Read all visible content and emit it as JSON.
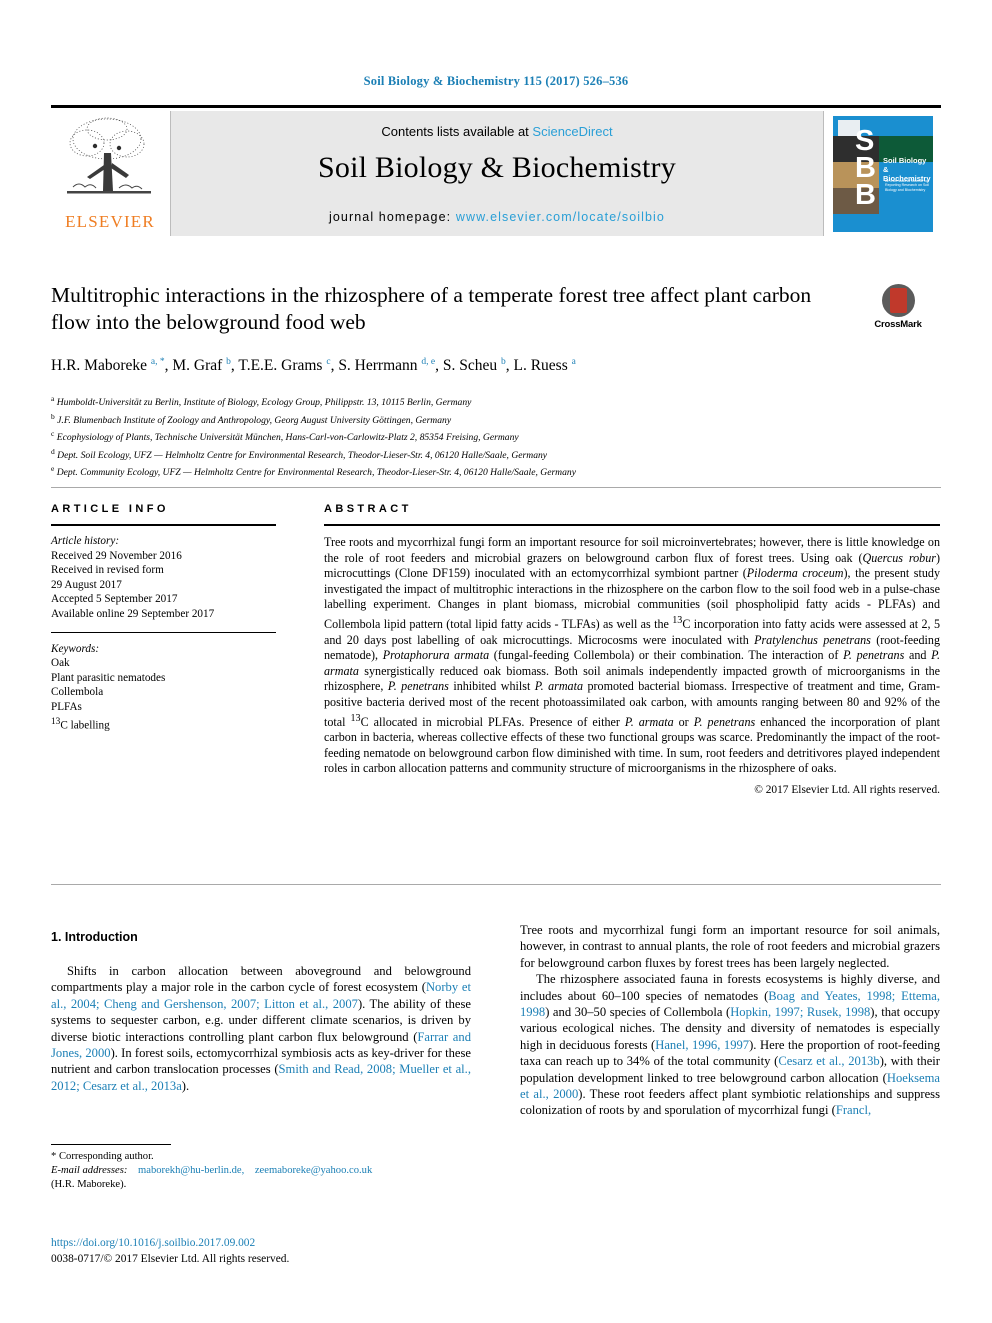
{
  "running_head": "Soil Biology & Biochemistry 115 (2017) 526–536",
  "masthead": {
    "contents_prefix": "Contents lists available at ",
    "sciencedirect": "ScienceDirect",
    "journal_name": "Soil Biology & Biochemistry",
    "homepage_prefix": "journal homepage: ",
    "homepage_url": "www.elsevier.com/locate/soilbio",
    "publisher_wordmark": "ELSEVIER",
    "cover": {
      "letters": "S\nB\nB",
      "title_line1": "Soil Biology &",
      "title_line2": "Biochemistry",
      "subtext": "An International Journal for Reporting Research on Soil Biology and Biochemistry"
    }
  },
  "colors": {
    "link_blue": "#1b7fb5",
    "sciencedirect_blue": "#2a9fd6",
    "elsevier_orange": "#ef7d22",
    "cover_blue": "#1a8fd0",
    "masthead_grey": "#e8e8e8"
  },
  "article": {
    "title": "Multitrophic interactions in the rhizosphere of a temperate forest tree affect plant carbon flow into the belowground food web",
    "crossmark_label": "CrossMark",
    "authors": [
      {
        "name": "H.R. Maboreke",
        "marks": "a, *"
      },
      {
        "name": "M. Graf",
        "marks": "b"
      },
      {
        "name": "T.E.E. Grams",
        "marks": "c"
      },
      {
        "name": "S. Herrmann",
        "marks": "d, e"
      },
      {
        "name": "S. Scheu",
        "marks": "b"
      },
      {
        "name": "L. Ruess",
        "marks": "a"
      }
    ],
    "affiliations": [
      {
        "mark": "a",
        "text": "Humboldt-Universität zu Berlin, Institute of Biology, Ecology Group, Philippstr. 13, 10115 Berlin, Germany"
      },
      {
        "mark": "b",
        "text": "J.F. Blumenbach Institute of Zoology and Anthropology, Georg August University Göttingen, Germany"
      },
      {
        "mark": "c",
        "text": "Ecophysiology of Plants, Technische Universität München, Hans-Carl-von-Carlowitz-Platz 2, 85354 Freising, Germany"
      },
      {
        "mark": "d",
        "text": "Dept. Soil Ecology, UFZ — Helmholtz Centre for Environmental Research, Theodor-Lieser-Str. 4, 06120 Halle/Saale, Germany"
      },
      {
        "mark": "e",
        "text": "Dept. Community Ecology, UFZ — Helmholtz Centre for Environmental Research, Theodor-Lieser-Str. 4, 06120 Halle/Saale, Germany"
      }
    ]
  },
  "article_info": {
    "heading": "ARTICLE INFO",
    "history_label": "Article history:",
    "history": [
      "Received 29 November 2016",
      "Received in revised form",
      "29 August 2017",
      "Accepted 5 September 2017",
      "Available online 29 September 2017"
    ],
    "keywords_label": "Keywords:",
    "keywords": [
      "Oak",
      "Plant parasitic nematodes",
      "Collembola",
      "PLFAs",
      "13C labelling"
    ]
  },
  "abstract": {
    "heading": "ABSTRACT",
    "text": "Tree roots and mycorrhizal fungi form an important resource for soil microinvertebrates; however, there is little knowledge on the role of root feeders and microbial grazers on belowground carbon flux of forest trees. Using oak (Quercus robur) microcuttings (Clone DF159) inoculated with an ectomycorrhizal symbiont partner (Piloderma croceum), the present study investigated the impact of multitrophic interactions in the rhizosphere on the carbon flow to the soil food web in a pulse-chase labelling experiment. Changes in plant biomass, microbial communities (soil phospholipid fatty acids - PLFAs) and Collembola lipid pattern (total lipid fatty acids - TLFAs) as well as the 13C incorporation into fatty acids were assessed at 2, 5 and 20 days post labelling of oak microcuttings. Microcosms were inoculated with Pratylenchus penetrans (root-feeding nematode), Protaphorura armata (fungal-feeding Collembola) or their combination. The interaction of P. penetrans and P. armata synergistically reduced oak biomass. Both soil animals independently impacted growth of microorganisms in the rhizosphere, P. penetrans inhibited whilst P. armata promoted bacterial biomass. Irrespective of treatment and time, Gram-positive bacteria derived most of the recent photoassimilated oak carbon, with amounts ranging between 80 and 92% of the total 13C allocated in microbial PLFAs. Presence of either P. armata or P. penetrans enhanced the incorporation of plant carbon in bacteria, whereas collective effects of these two functional groups was scarce. Predominantly the impact of the root-feeding nematode on belowground carbon flow diminished with time. In sum, root feeders and detritivores played independent roles in carbon allocation patterns and community structure of microorganisms in the rhizosphere of oaks.",
    "copyright": "© 2017 Elsevier Ltd. All rights reserved."
  },
  "body": {
    "section_number_title": "1. Introduction",
    "left_column_paragraph": "Shifts in carbon allocation between aboveground and belowground compartments play a major role in the carbon cycle of forest ecosystem (Norby et al., 2004; Cheng and Gershenson, 2007; Litton et al., 2007). The ability of these systems to sequester carbon, e.g. under different climate scenarios, is driven by diverse biotic interactions controlling plant carbon flux belowground (Farrar and Jones, 2000). In forest soils, ectomycorrhizal symbiosis acts as key-driver for these nutrient and carbon translocation processes (Smith and Read, 2008; Mueller et al., 2012; Cesarz et al., 2013a).",
    "right_column_paragraph_1": "Tree roots and mycorrhizal fungi form an important resource for soil animals, however, in contrast to annual plants, the role of root feeders and microbial grazers for belowground carbon fluxes by forest trees has been largely neglected.",
    "right_column_paragraph_2": "The rhizosphere associated fauna in forests ecosystems is highly diverse, and includes about 60–100 species of nematodes (Boag and Yeates, 1998; Ettema, 1998) and 30–50 species of Collembola (Hopkin, 1997; Rusek, 1998), that occupy various ecological niches. The density and diversity of nematodes is especially high in deciduous forests (Hanel, 1996, 1997). Here the proportion of root-feeding taxa can reach up to 34% of the total community (Cesarz et al., 2013b), with their population development linked to tree belowground carbon allocation (Hoeksema et al., 2000). These root feeders affect plant symbiotic relationships and suppress colonization of roots by and sporulation of mycorrhizal fungi (Francl,"
  },
  "footnotes": {
    "corresponding_marker": "*",
    "corresponding_text": "Corresponding author.",
    "email_label": "E-mail addresses:",
    "emails": [
      "maborekh@hu-berlin.de,",
      "zeemaboreke@yahoo.co.uk"
    ],
    "email_owner": "(H.R. Maboreke).",
    "doi": "https://doi.org/10.1016/j.soilbio.2017.09.002",
    "issn_line": "0038-0717/© 2017 Elsevier Ltd. All rights reserved."
  }
}
